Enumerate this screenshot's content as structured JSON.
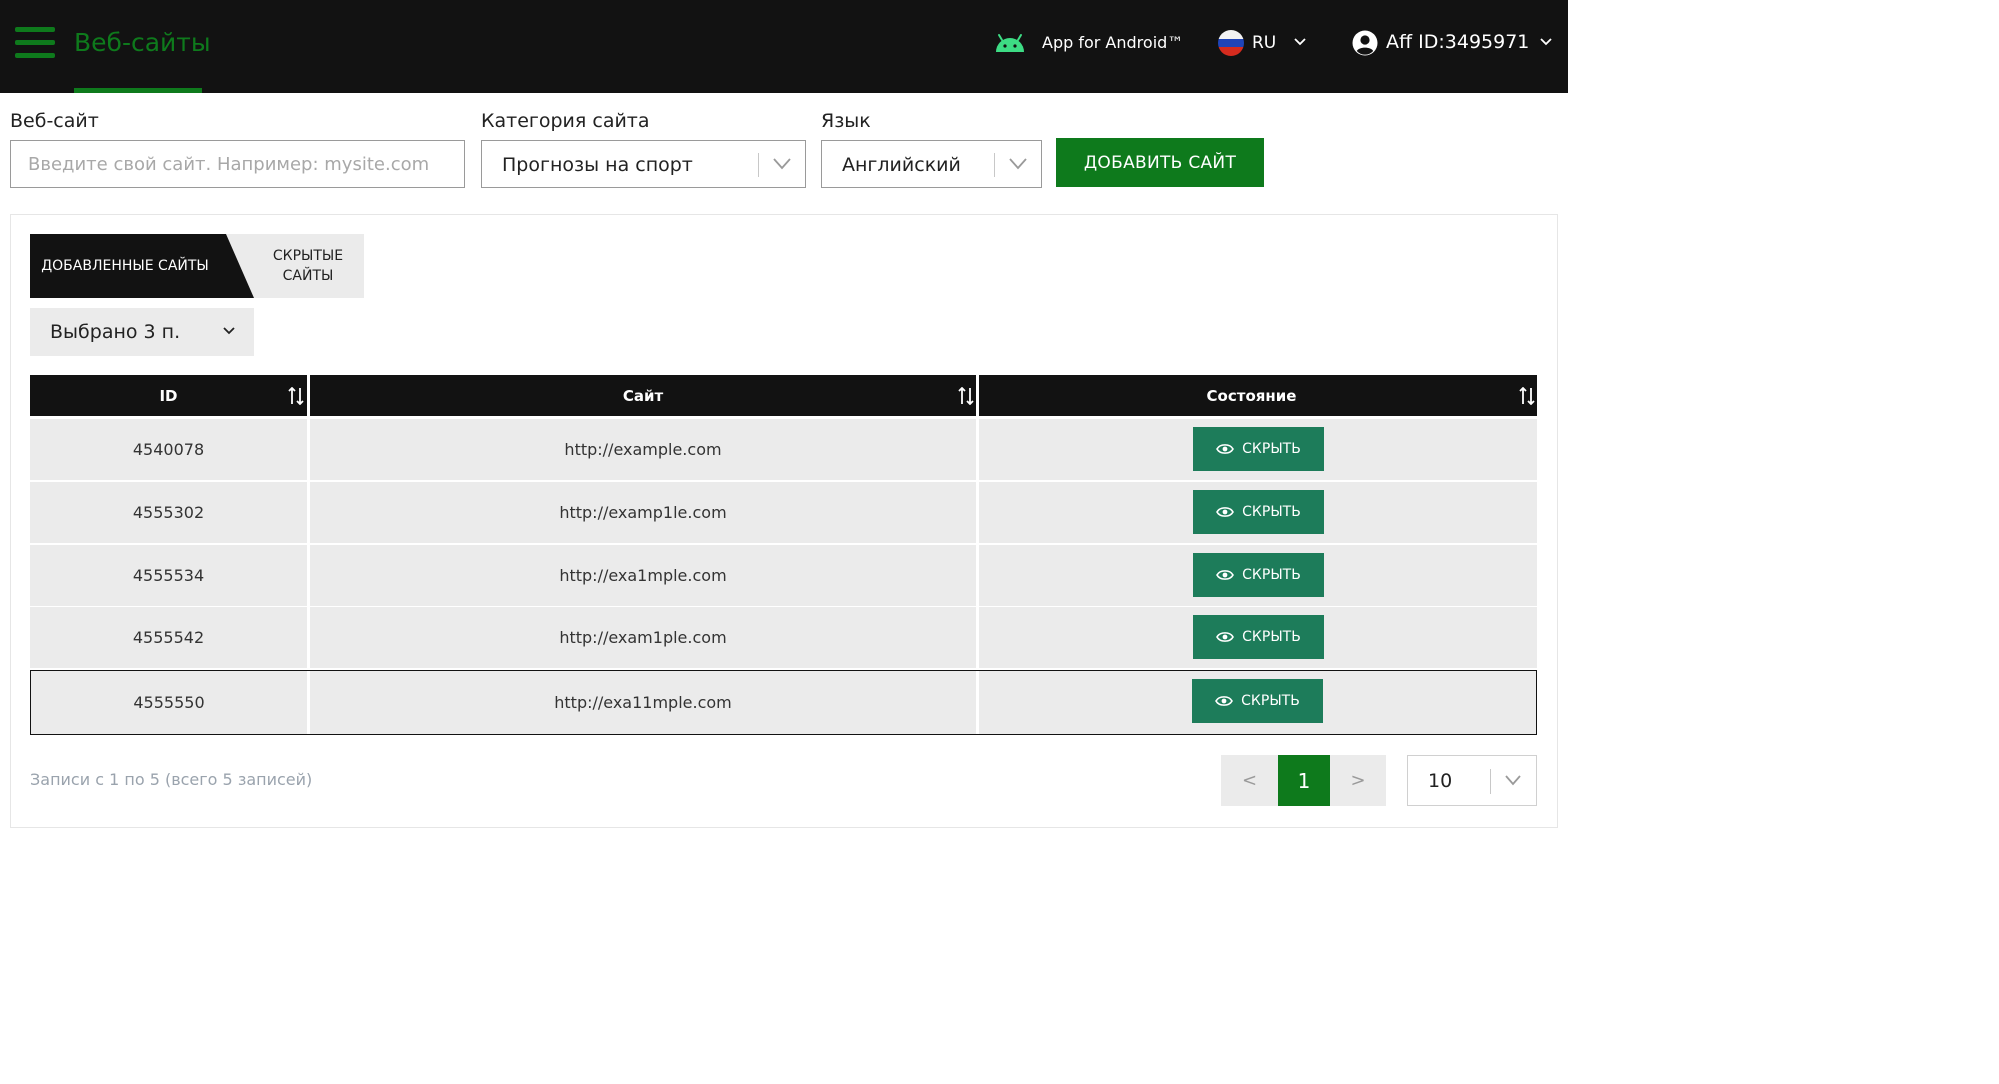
{
  "header": {
    "brand": "Веб-сайты",
    "android_label": "App for Android™",
    "language_code": "RU",
    "aff_label": "Aff ID:3495971",
    "accent_color": "#0e7a1c",
    "background_color": "#121212"
  },
  "form": {
    "website_label": "Веб-сайт",
    "website_placeholder": "Введите свой сайт. Например: mysite.com",
    "category_label": "Категория сайта",
    "category_value": "Прогнозы на спорт",
    "language_label": "Язык",
    "language_value": "Английский",
    "add_button": "ДОБАВИТЬ САЙТ"
  },
  "tabs": [
    {
      "label": "ДОБАВЛЕННЫЕ САЙТЫ",
      "active": true
    },
    {
      "label": "СКРЫТЫЕ САЙТЫ",
      "active": false
    }
  ],
  "column_select": {
    "value": "Выбрано 3 п."
  },
  "table": {
    "columns": [
      "ID",
      "Сайт",
      "Состояние"
    ],
    "rows": [
      {
        "id": "4540078",
        "site": "http://example.com",
        "action": "СКРЫТЬ"
      },
      {
        "id": "4555302",
        "site": "http://examp1le.com",
        "action": "СКРЫТЬ"
      },
      {
        "id": "4555534",
        "site": "http://exa1mple.com",
        "action": "СКРЫТЬ"
      },
      {
        "id": "4555542",
        "site": "http://exam1ple.com",
        "action": "СКРЫТЬ"
      },
      {
        "id": "4555550",
        "site": "http://exa11mple.com",
        "action": "СКРЫТЬ"
      }
    ],
    "action_color": "#1d7c5a"
  },
  "footer": {
    "records": "Записи с 1 по 5 (всего 5 записей)",
    "prev": "<",
    "current_page": "1",
    "next": ">",
    "per_page": "10"
  }
}
